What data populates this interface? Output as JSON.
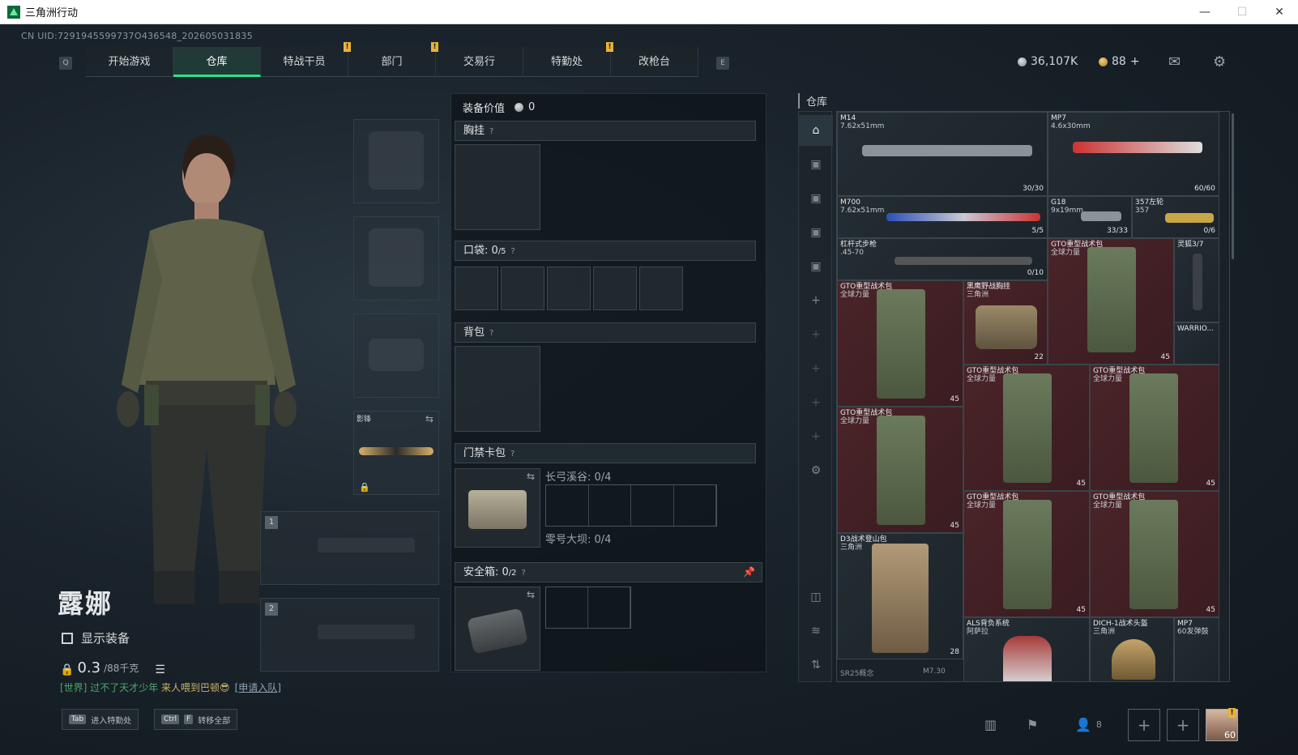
{
  "window": {
    "title": "三角洲行动",
    "minimize": "—",
    "maximize": "☐",
    "close": "✕"
  },
  "uid": "CN UID:7291945599737O436548_202605031835",
  "nav": {
    "left_key": "Q",
    "right_key": "E",
    "tabs": [
      {
        "label": "开始游戏"
      },
      {
        "label": "仓库"
      },
      {
        "label": "特战干员",
        "badge": "!"
      },
      {
        "label": "部门",
        "badge": "!"
      },
      {
        "label": "交易行"
      },
      {
        "label": "特勤处",
        "badge": "!"
      },
      {
        "label": "改枪台"
      }
    ]
  },
  "currency": {
    "silver": "36,107K",
    "gold": "88",
    "plus": "+"
  },
  "character": {
    "name": "露娜",
    "show_equipment": "显示装备",
    "weight": "0.3",
    "weight_max": "/88千克"
  },
  "melee": {
    "label": "影锋"
  },
  "weapon_slots": [
    "1",
    "2"
  ],
  "chat": {
    "channel": "[世界]",
    "text": "过不了天才少年",
    "msg": "来人喂到巴顿😎",
    "apply": "[申请入队]"
  },
  "bottom": {
    "tab_key": "Tab",
    "tab_label": "进入特勤处",
    "ctrl_key": "Ctrl",
    "f_key": "F",
    "ctrl_label": "转移全部",
    "friends": "8",
    "avatar_level": "60"
  },
  "equipment": {
    "value_label": "装备价值",
    "value": "0",
    "chest": "胸挂",
    "pockets_label": "口袋:",
    "pockets_val": "0",
    "pockets_max": "/5",
    "backpack": "背包",
    "keycard": "门禁卡包",
    "map1": "长弓溪谷: 0/4",
    "map2": "零号大坝: 0/4",
    "safe_label": "安全箱:",
    "safe_val": "0",
    "safe_max": "/2",
    "help": "?"
  },
  "storage": {
    "title": "仓库",
    "items": [
      {
        "name": "M14",
        "sub": "7.62x51mm",
        "count": "30/30"
      },
      {
        "name": "MP7",
        "sub": "4.6x30mm",
        "count": "60/60"
      },
      {
        "name": "M700",
        "sub": "7.62x51mm",
        "count": "5/5"
      },
      {
        "name": "G18",
        "sub": "9x19mm",
        "count": "33/33"
      },
      {
        "name": "357左轮",
        "sub": "357",
        "count": "0/6"
      },
      {
        "name": "杠杆式步枪",
        "sub": ".45-70",
        "count": "0/10"
      },
      {
        "name": "GTO重型战术包",
        "sub": "全球力量",
        "count": "45"
      },
      {
        "name": "灵狐3/7",
        "sub": "",
        "count": ""
      },
      {
        "name": "GTO重型战术包",
        "sub": "全球力量",
        "count": "45"
      },
      {
        "name": "黑鹰野战胸挂",
        "sub": "三角洲",
        "count": "22"
      },
      {
        "name": "WARRIO...",
        "sub": "",
        "count": ""
      },
      {
        "name": "GTO重型战术包",
        "sub": "全球力量",
        "count": "45"
      },
      {
        "name": "GTO重型战术包",
        "sub": "全球力量",
        "count": "45"
      },
      {
        "name": "GTO重型战术包",
        "sub": "全球力量",
        "count": "45"
      },
      {
        "name": "GTO重型战术包",
        "sub": "全球力量",
        "count": "45"
      },
      {
        "name": "GTO重型战术包",
        "sub": "全球力量",
        "count": "45"
      },
      {
        "name": "D3战术登山包",
        "sub": "三角洲",
        "count": "28"
      },
      {
        "name": "ALS背负系统",
        "sub": "阿萨拉",
        "count": ""
      },
      {
        "name": "DICH-1战术头盔",
        "sub": "三角洲",
        "count": ""
      },
      {
        "name": "MP7",
        "sub": "60发弹鼓",
        "count": ""
      },
      {
        "name": "SR25概念",
        "sub": "",
        "count": ""
      },
      {
        "name": "M7.30",
        "sub": "",
        "count": ""
      }
    ]
  }
}
